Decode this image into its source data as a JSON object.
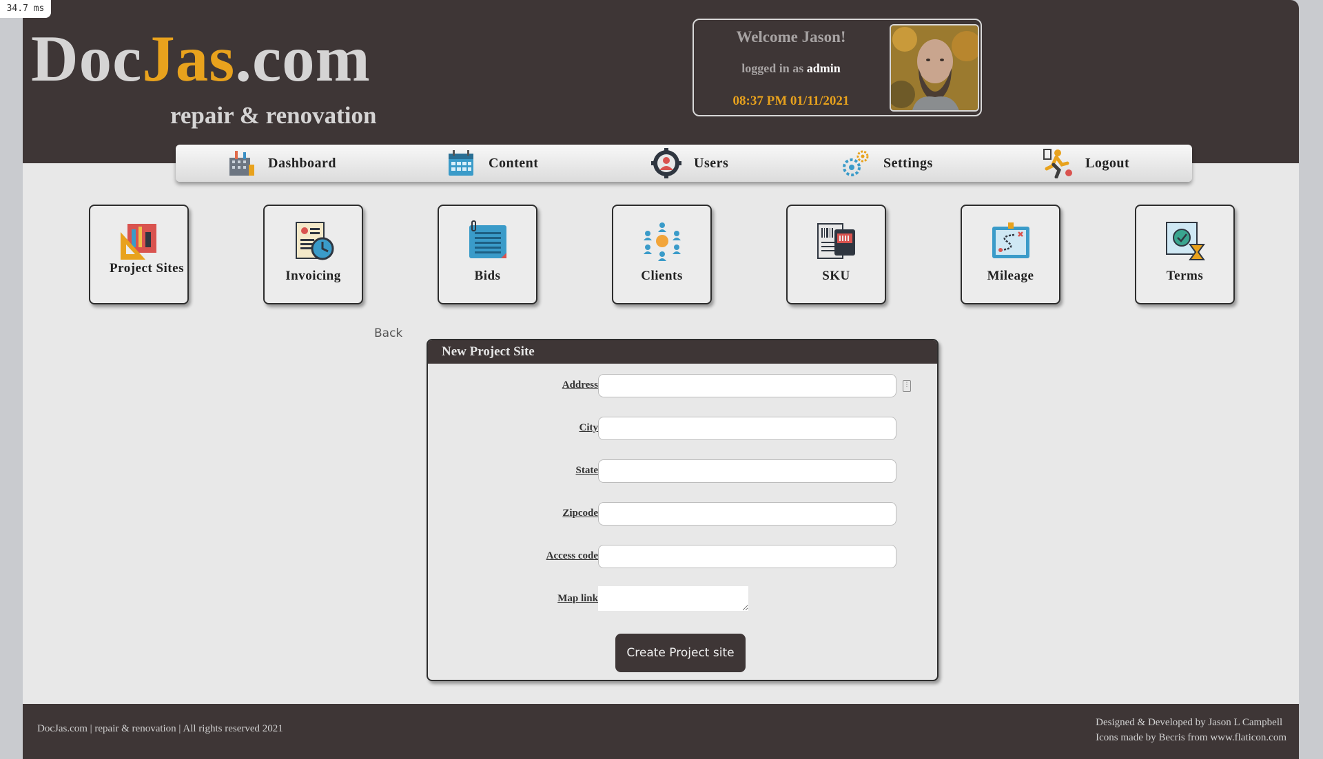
{
  "timer": "34.7 ms",
  "brand": {
    "name_part1": "Doc",
    "name_part2": "Jas",
    "name_part3": ".com",
    "tagline": "repair & renovation"
  },
  "welcome": {
    "greeting": "Welcome Jason!",
    "logged_in_prefix": "logged in as",
    "role": "admin",
    "datetime": "08:37 PM 01/11/2021"
  },
  "nav": [
    {
      "label": "Dashboard",
      "icon": "dashboard-icon"
    },
    {
      "label": "Content",
      "icon": "calendar-grid-icon"
    },
    {
      "label": "Users",
      "icon": "user-gear-icon"
    },
    {
      "label": "Settings",
      "icon": "gears-icon"
    },
    {
      "label": "Logout",
      "icon": "runner-exit-icon"
    }
  ],
  "tiles": [
    {
      "label": "Project Sites",
      "icon": "blueprint-tools-icon"
    },
    {
      "label": "Invoicing",
      "icon": "invoice-clock-icon"
    },
    {
      "label": "Bids",
      "icon": "clipboard-list-icon"
    },
    {
      "label": "Clients",
      "icon": "people-network-icon"
    },
    {
      "label": "SKU",
      "icon": "barcode-document-icon"
    },
    {
      "label": "Mileage",
      "icon": "route-map-icon"
    },
    {
      "label": "Terms",
      "icon": "certificate-hourglass-icon"
    }
  ],
  "back_label": "Back",
  "form": {
    "title": "New Project Site",
    "fields": [
      {
        "label": "Address",
        "value": "",
        "placeholder": ""
      },
      {
        "label": "City",
        "value": "",
        "placeholder": ""
      },
      {
        "label": "State",
        "value": "",
        "placeholder": ""
      },
      {
        "label": "Zipcode",
        "value": "",
        "placeholder": ""
      },
      {
        "label": "Access code",
        "value": "",
        "placeholder": ""
      },
      {
        "label": "Map link",
        "value": "",
        "placeholder": ""
      }
    ],
    "submit_label": "Create Project site"
  },
  "footer": {
    "left": "DocJas.com | repair & renovation | All rights reserved 2021",
    "credit_line1": "Designed & Developed by Jason L Campbell",
    "credit_line2": "Icons made by Becris from www.flaticon.com"
  },
  "colors": {
    "header_bg": "#3e3636",
    "accent": "#e8a21d",
    "page_bg": "#e8e8e8"
  }
}
